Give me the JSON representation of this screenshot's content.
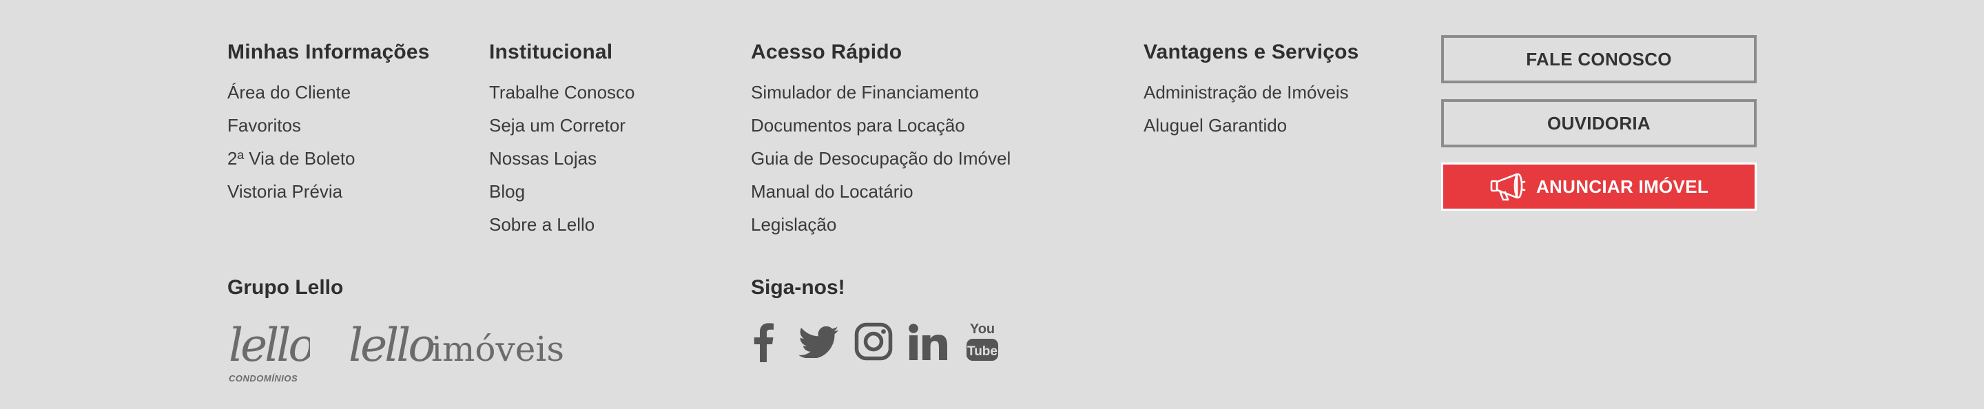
{
  "columns": [
    {
      "title": "Minhas Informações",
      "links": [
        "Área do Cliente",
        "Favoritos",
        "2ª Via de Boleto",
        "Vistoria Prévia"
      ]
    },
    {
      "title": "Institucional",
      "links": [
        "Trabalhe Conosco",
        "Seja um Corretor",
        "Nossas Lojas",
        "Blog",
        "Sobre a Lello"
      ]
    },
    {
      "title": "Acesso Rápido",
      "links": [
        "Simulador de Financiamento",
        "Documentos para Locação",
        "Guia de Desocupação do Imóvel",
        "Manual do Locatário",
        "Legislação"
      ]
    },
    {
      "title": "Vantagens e Serviços",
      "links": [
        "Administração de Imóveis",
        "Aluguel Garantido"
      ]
    }
  ],
  "buttons": {
    "fale_conosco": "FALE CONOSCO",
    "ouvidoria": "OUVIDORIA",
    "anunciar": "ANUNCIAR IMÓVEL",
    "anunciar_icon": "megaphone-icon"
  },
  "grupo": {
    "title": "Grupo Lello",
    "logo_condominios_main": "lello",
    "logo_condominios_sub": "CONDOMÍNIOS",
    "logo_imoveis_main": "lello",
    "logo_imoveis_suffix": "imóveis"
  },
  "social": {
    "title": "Siga-nos!",
    "icons": [
      "facebook-icon",
      "twitter-icon",
      "instagram-icon",
      "linkedin-icon",
      "youtube-icon"
    ],
    "youtube_top": "You",
    "youtube_bottom": "Tube"
  },
  "colors": {
    "background": "#dedede",
    "text": "#333333",
    "accent_red": "#e63a3e",
    "outline": "#8c8c8c",
    "icon_gray": "#555555"
  }
}
